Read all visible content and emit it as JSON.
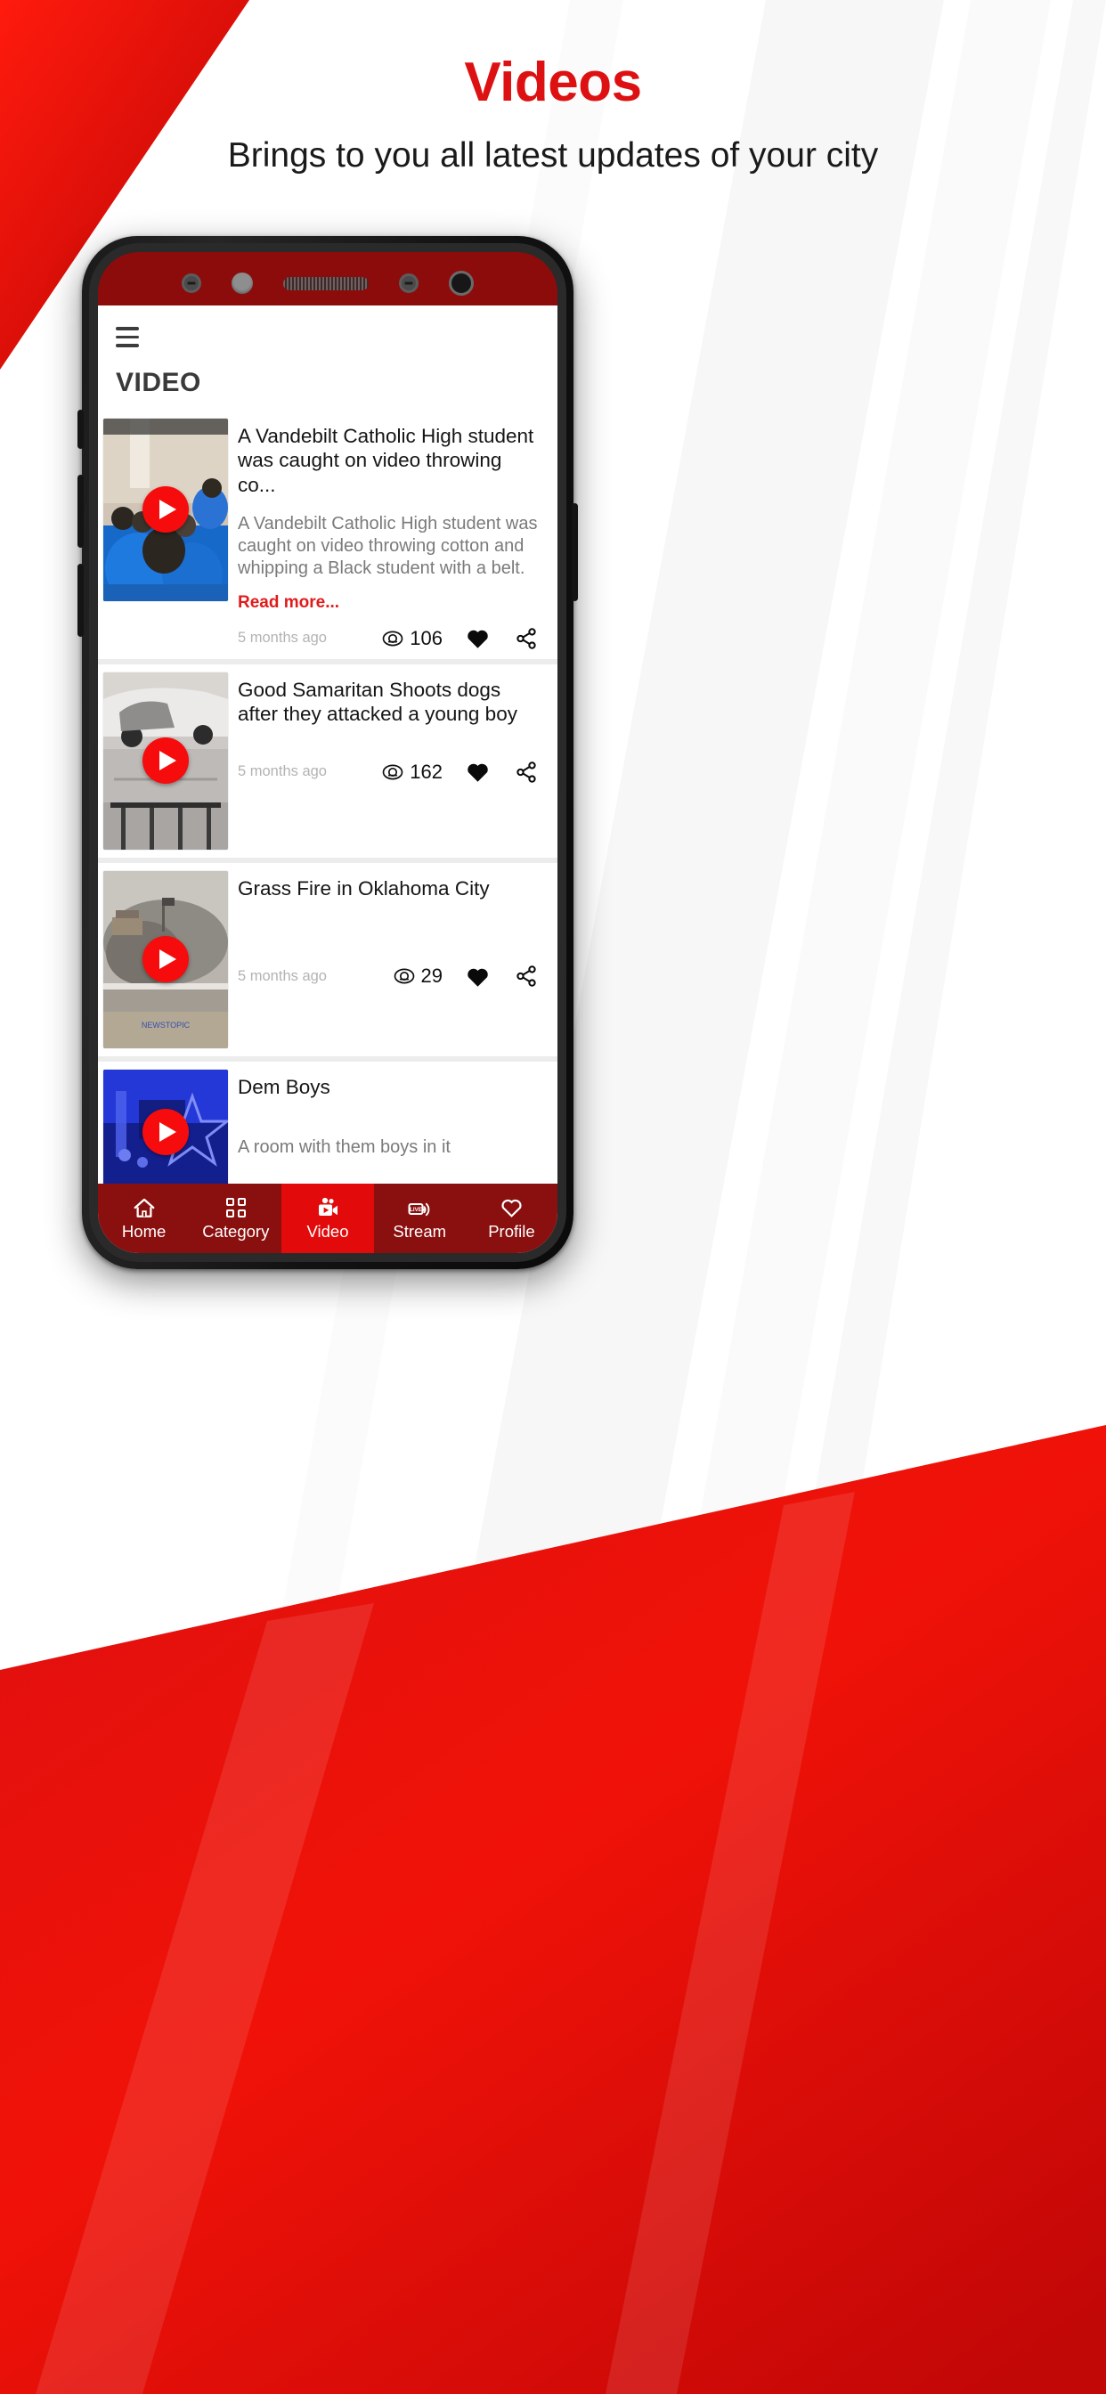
{
  "promo": {
    "title": "Videos",
    "subtitle": "Brings to you all latest updates of your city",
    "title_color": "#dd1111"
  },
  "theme": {
    "brand_red": "#e20a0a",
    "dark_red": "#8a0f0f",
    "accent_link": "#e11b1b",
    "muted_text": "#b3b3b3"
  },
  "device": {
    "sensors": [
      "proximity-sensor",
      "front-camera-dot",
      "earpiece-speaker",
      "proximity-sensor-2",
      "front-camera-lens"
    ]
  },
  "app": {
    "menu_icon": "hamburger-menu-icon",
    "page_title": "VIDEO"
  },
  "videos": [
    {
      "title": "A Vandebilt Catholic High student was caught on video throwing co...",
      "description": "A Vandebilt Catholic High student was caught on video throwing cotton and whipping a Black student with a belt.",
      "read_more": "Read more...",
      "ago": "5 months ago",
      "views": "106",
      "liked": true,
      "thumb_alt": "students-in-blue-uniforms"
    },
    {
      "title": "Good Samaritan Shoots dogs after they attacked a young boy",
      "description": "",
      "read_more": "",
      "ago": "5 months ago",
      "views": "162",
      "liked": true,
      "thumb_alt": "person-beside-white-car"
    },
    {
      "title": "Grass Fire in Oklahoma City",
      "description": "",
      "read_more": "",
      "ago": "5 months ago",
      "views": "29",
      "liked": true,
      "thumb_alt": "grass-fire-smoke"
    },
    {
      "title": "Dem Boys",
      "description": "A room with them boys in it",
      "read_more": "",
      "ago": "",
      "views": "",
      "liked": true,
      "thumb_alt": "blue-lit-room"
    }
  ],
  "icons": {
    "views": "eye-icon",
    "like": "heart-filled-icon",
    "share": "share-icon",
    "play": "play-icon"
  },
  "bottom_nav": {
    "items": [
      {
        "label": "Home",
        "icon": "home-icon",
        "active": false
      },
      {
        "label": "Category",
        "icon": "grid-icon",
        "active": false
      },
      {
        "label": "Video",
        "icon": "video-camera-icon",
        "active": true
      },
      {
        "label": "Stream",
        "icon": "live-stream-icon",
        "active": false
      },
      {
        "label": "Profile",
        "icon": "heart-outline-icon",
        "active": false
      }
    ]
  }
}
